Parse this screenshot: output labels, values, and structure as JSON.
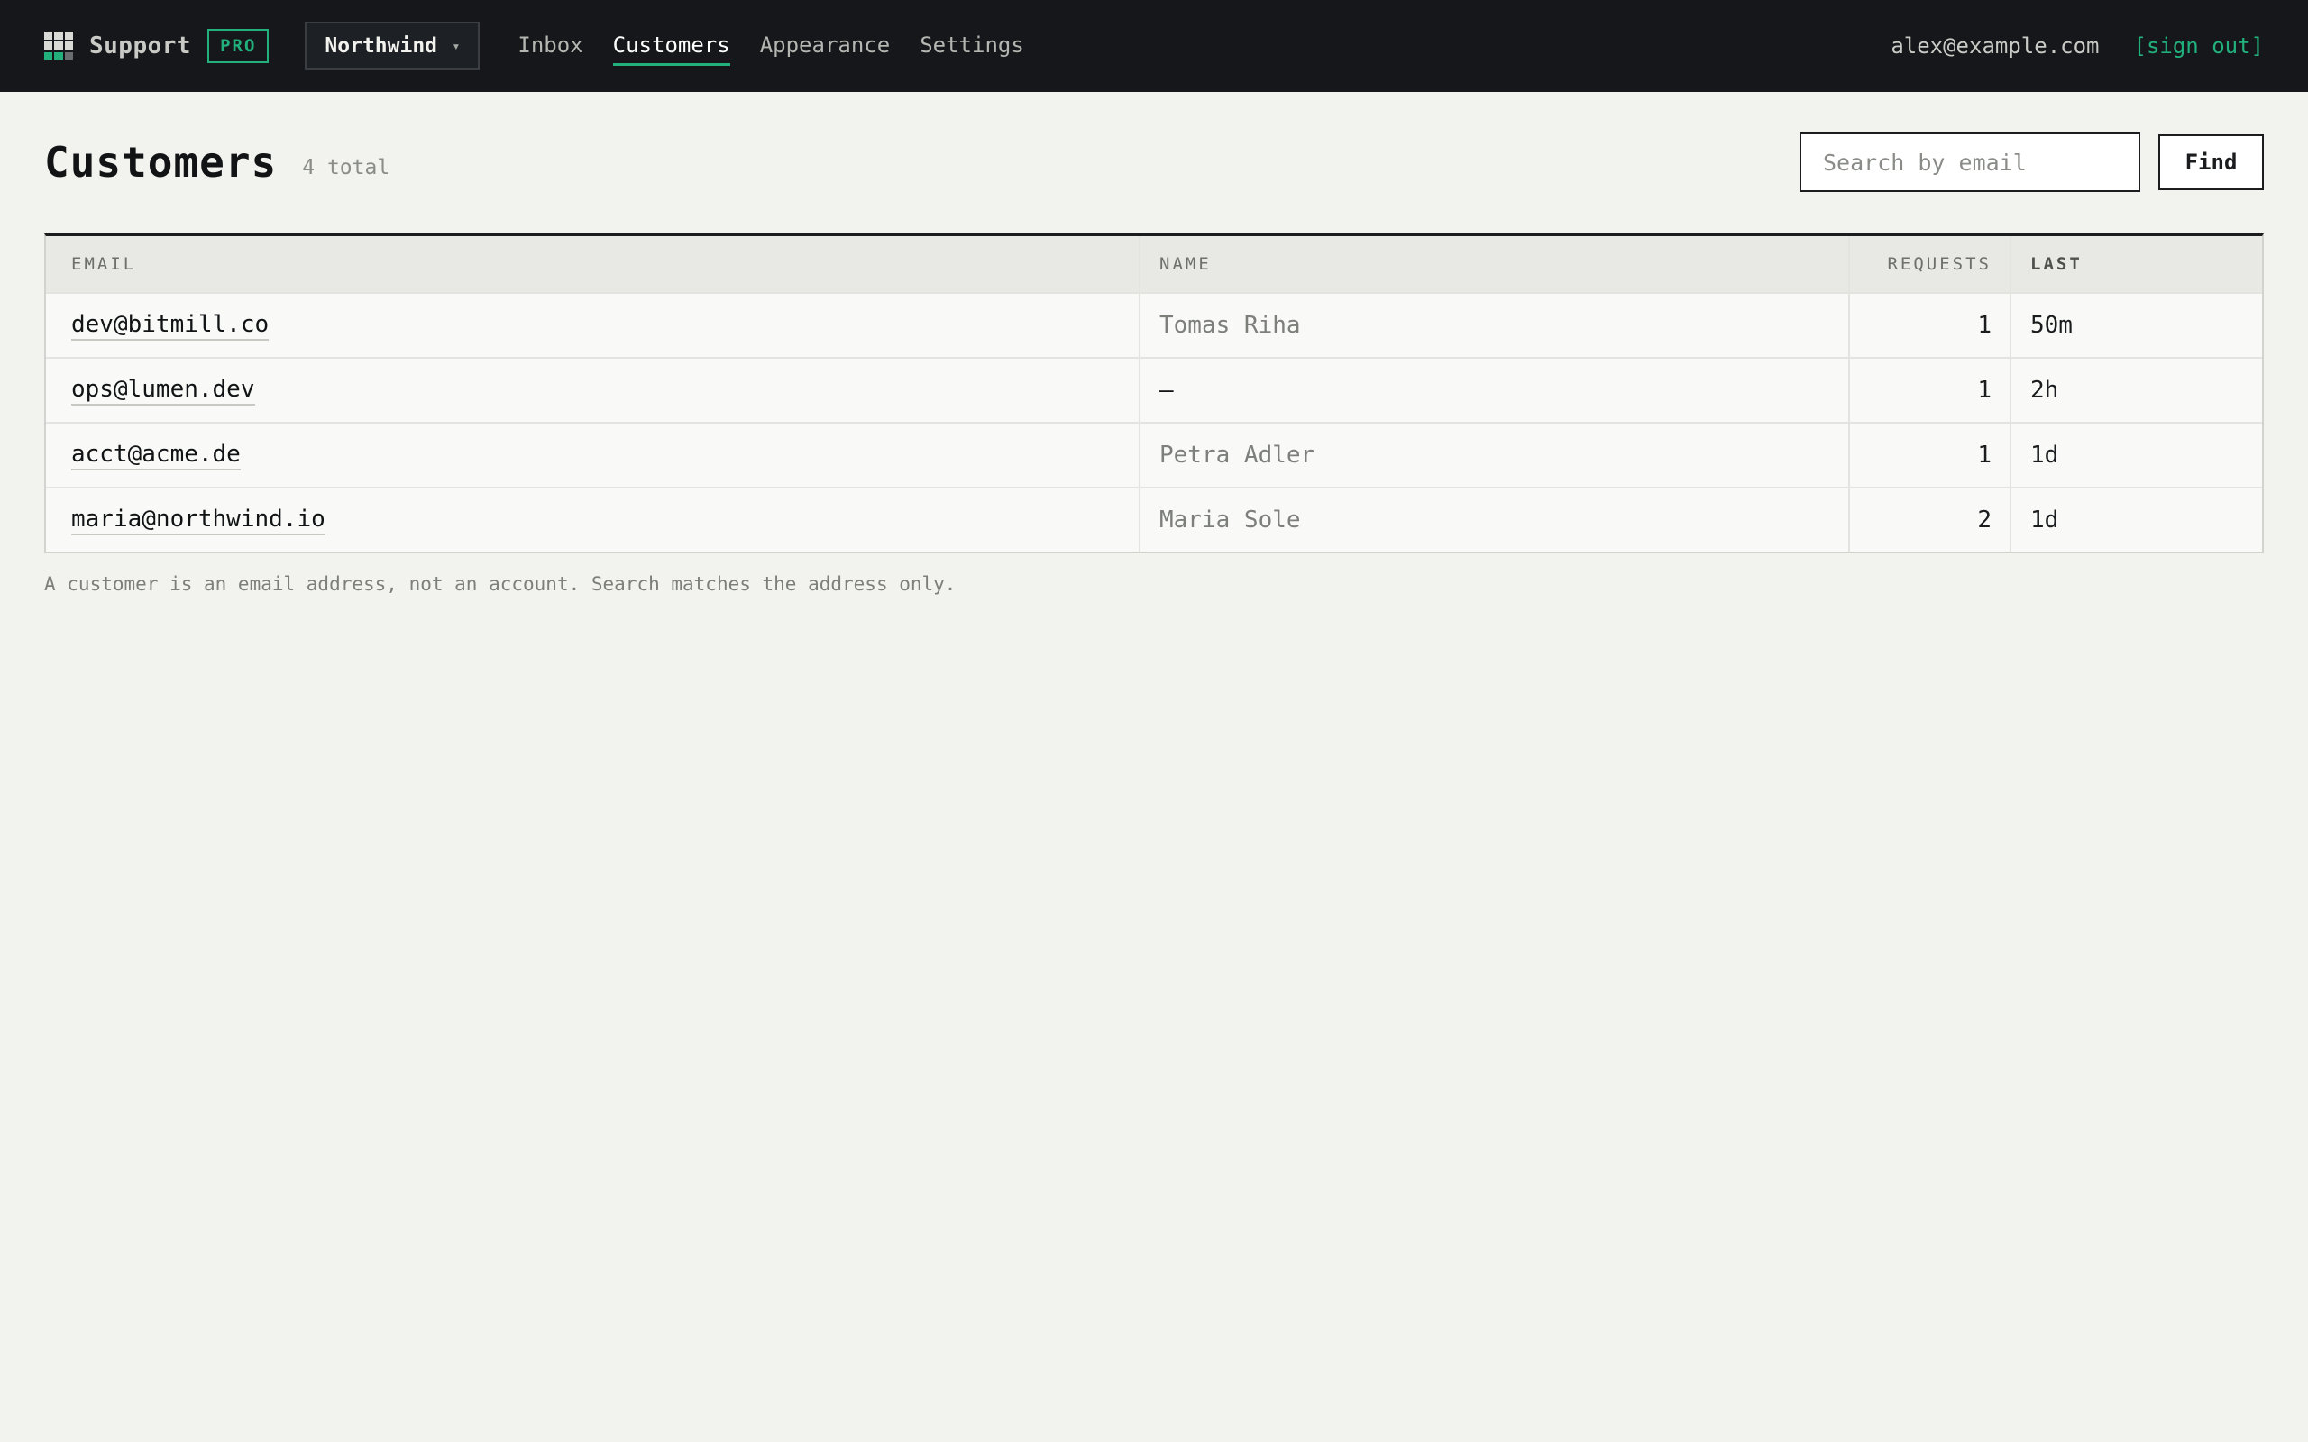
{
  "app": {
    "brand": "Support",
    "badge": "PRO",
    "logo_icon": "grid-logo-icon",
    "accent_color": "#22b07d"
  },
  "workspace": {
    "selected": "Northwind",
    "caret": "▾"
  },
  "nav": {
    "items": [
      {
        "label": "Inbox",
        "active": false
      },
      {
        "label": "Customers",
        "active": true
      },
      {
        "label": "Appearance",
        "active": false
      },
      {
        "label": "Settings",
        "active": false
      }
    ]
  },
  "user": {
    "email": "alex@example.com",
    "sign_out": "[sign out]"
  },
  "page": {
    "title": "Customers",
    "count": "4 total"
  },
  "search": {
    "placeholder": "Search by email",
    "value": "",
    "button": "Find"
  },
  "table": {
    "columns": [
      "EMAIL",
      "NAME",
      "REQUESTS",
      "LAST"
    ],
    "rows": [
      {
        "email": "dev@bitmill.co",
        "name": "Tomas Riha",
        "requests": "1",
        "last": "50m"
      },
      {
        "email": "ops@lumen.dev",
        "name": "—",
        "requests": "1",
        "last": "2h"
      },
      {
        "email": "acct@acme.de",
        "name": "Petra Adler",
        "requests": "1",
        "last": "1d"
      },
      {
        "email": "maria@northwind.io",
        "name": "Maria Sole",
        "requests": "2",
        "last": "1d"
      }
    ]
  },
  "footnote": "A customer is an email address, not an account. Search matches the address only."
}
